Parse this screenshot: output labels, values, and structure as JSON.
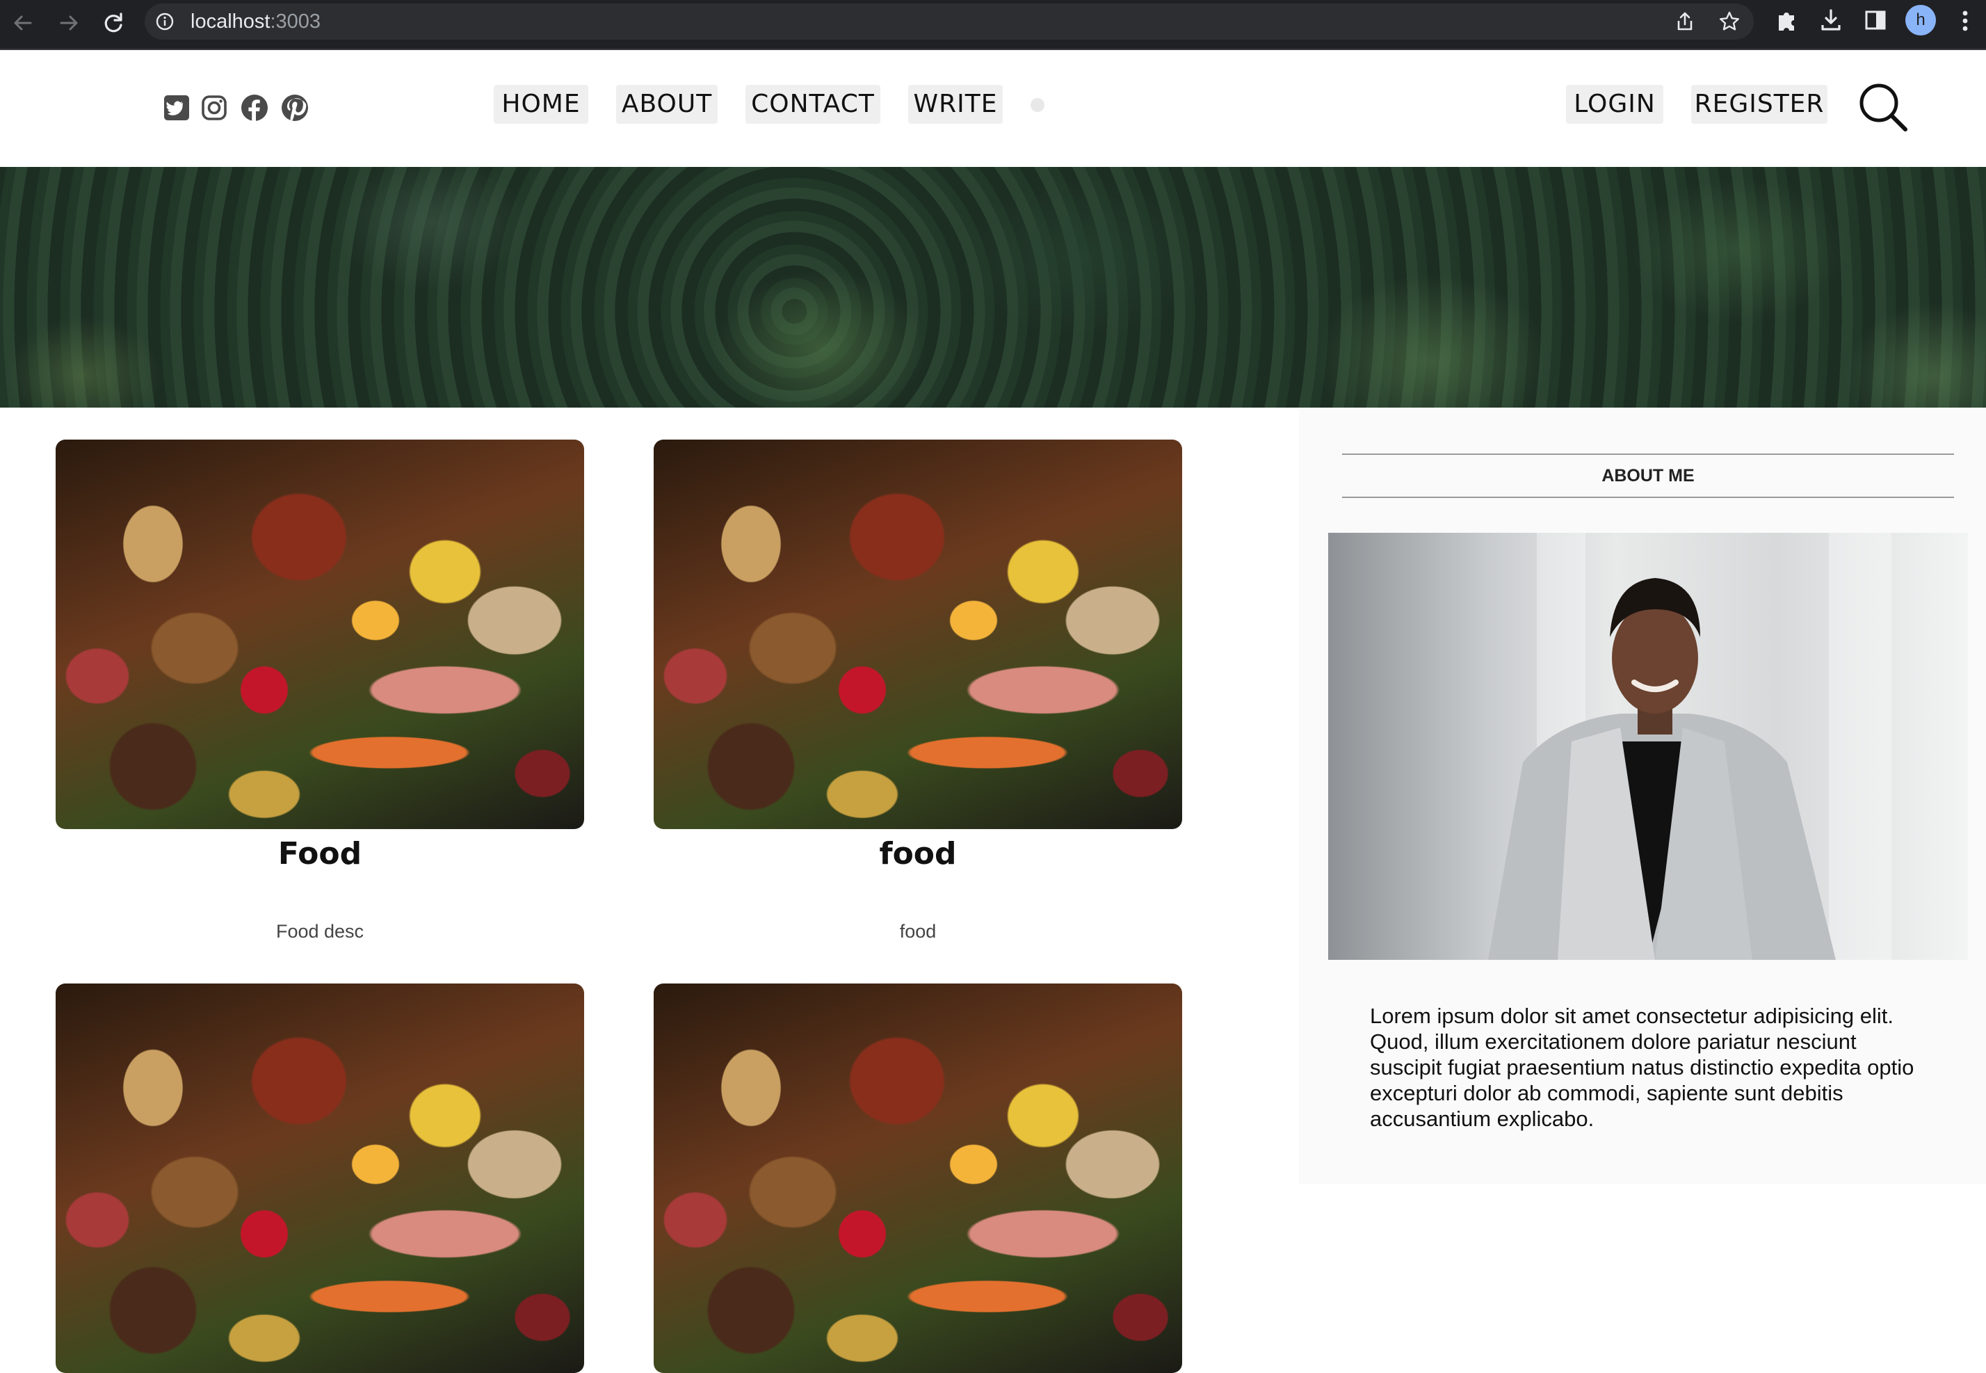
{
  "browser": {
    "url_host": "localhost",
    "url_port": ":3003",
    "avatar_letter": "h"
  },
  "nav": {
    "social_icons": [
      "twitter-icon",
      "instagram-icon",
      "facebook-icon",
      "pinterest-icon"
    ],
    "menu": [
      "HOME",
      "ABOUT",
      "CONTACT",
      "WRITE"
    ],
    "auth": [
      "LOGIN",
      "REGISTER"
    ]
  },
  "posts": [
    {
      "title": "Food",
      "desc": "Food desc"
    },
    {
      "title": "food",
      "desc": "food"
    },
    {
      "title": "",
      "desc": ""
    },
    {
      "title": "",
      "desc": ""
    }
  ],
  "sidebar": {
    "title": "ABOUT ME",
    "text": "Lorem ipsum dolor sit amet consectetur adipisicing elit. Quod, illum exercitationem dolore pariatur nesciunt suscipit fugiat praesentium natus distinctio expedita optio excepturi dolor ab commodi, sapiente sunt debitis accusantium explicabo."
  },
  "colors": {
    "browser_chrome": "#202124",
    "menu_button_bg": "#efefef",
    "sidebar_bg": "#fafafa"
  }
}
